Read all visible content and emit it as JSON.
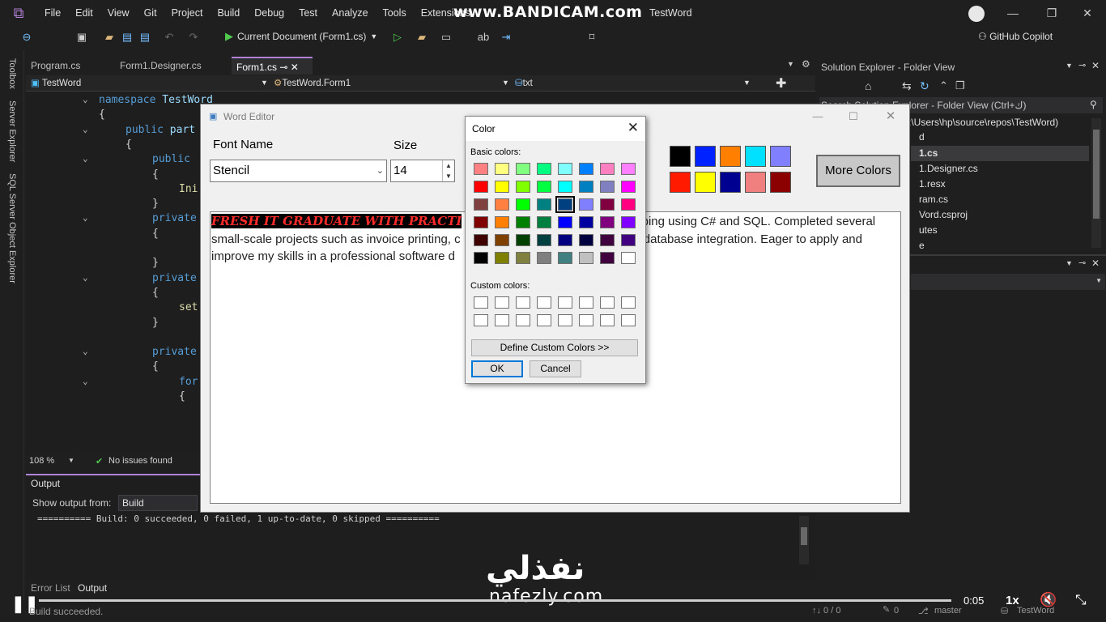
{
  "menubar": {
    "items": [
      "File",
      "Edit",
      "View",
      "Git",
      "Project",
      "Build",
      "Debug",
      "Test",
      "Analyze",
      "Tools",
      "Extensions"
    ],
    "watermark": "www.BANDICAM.com",
    "window_title": "TestWord"
  },
  "toolbar": {
    "run_label": "Current Document (Form1.cs)",
    "copilot_label": "GitHub Copilot"
  },
  "sidebar": {
    "toolbox": "Toolbox",
    "server_explorer": "Server Explorer",
    "sql_explorer": "SQL Server Object Explorer"
  },
  "editor": {
    "tabs": [
      "Program.cs",
      "Form1.Designer.cs",
      "Form1.cs"
    ],
    "nav_project": "TestWord",
    "nav_class": "TestWord.Form1",
    "nav_member": "txt",
    "lines": [
      {
        "indent": 0,
        "kw": "namespace",
        "text": " TestWord"
      },
      {
        "indent": 0,
        "kw": "",
        "text": "{"
      },
      {
        "indent": 1,
        "kw": "public",
        "text": " part"
      },
      {
        "indent": 1,
        "kw": "",
        "text": "{"
      },
      {
        "indent": 2,
        "kw": "public",
        "text": ""
      },
      {
        "indent": 2,
        "kw": "",
        "text": "{"
      },
      {
        "indent": 3,
        "kw": "",
        "text": "Ini"
      },
      {
        "indent": 2,
        "kw": "",
        "text": "}"
      },
      {
        "indent": 2,
        "kw": "private",
        "text": ""
      },
      {
        "indent": 2,
        "kw": "",
        "text": "{"
      },
      {
        "indent": 2,
        "kw": "",
        "text": ""
      },
      {
        "indent": 2,
        "kw": "",
        "text": "}"
      },
      {
        "indent": 2,
        "kw": "private",
        "text": ""
      },
      {
        "indent": 2,
        "kw": "",
        "text": "{"
      },
      {
        "indent": 3,
        "kw": "",
        "text": "set"
      },
      {
        "indent": 2,
        "kw": "",
        "text": "}"
      },
      {
        "indent": 2,
        "kw": "",
        "text": ""
      },
      {
        "indent": 2,
        "kw": "private",
        "text": ""
      },
      {
        "indent": 2,
        "kw": "",
        "text": "{"
      },
      {
        "indent": 3,
        "kw": "for",
        "text": ""
      },
      {
        "indent": 3,
        "kw": "",
        "text": "{"
      }
    ],
    "zoom": "108 %",
    "issues": "No issues found"
  },
  "output": {
    "title": "Output",
    "show_from_label": "Show output from:",
    "show_from_value": "Build",
    "text": "========== Build: 0 succeeded, 0 failed, 1 up-to-date, 0 skipped =========="
  },
  "bottom_tabs": [
    "Error List",
    "Output"
  ],
  "solution": {
    "title": "Solution Explorer - Folder View",
    "search": "Search Solution Explorer - Folder View (Ctrl+ك)",
    "path": ":\\Users\\hp\\source\\repos\\TestWord)",
    "rows": [
      "d",
      "1.cs",
      "1.Designer.cs",
      "1.resx",
      "ram.cs",
      "Vord.csproj",
      "utes",
      "e"
    ]
  },
  "status": {
    "message": "Build succeeded.",
    "time": "0:05",
    "speed": "1x",
    "counts": "↑↓ 0 / 0",
    "pencil": "0",
    "branch": "master",
    "repo": "TestWord"
  },
  "brand": {
    "arabic": "نفذلي",
    "latin": "nafezly.com"
  },
  "form": {
    "title": "Word Editor",
    "font_label": "Font Name",
    "size_label": "Size",
    "font_value": "Stencil",
    "size_value": "14",
    "more_colors": "More Colors",
    "swatches_row1": [
      "#000000",
      "#0022ff",
      "#ff8000",
      "#00e0ff",
      "#8080ff"
    ],
    "swatches_row2": [
      "#ff1a00",
      "#ffff00",
      "#000090",
      "#f08080",
      "#8b0000"
    ],
    "text_highlight": "FRESH IT GRADUATE WITH PRACTI",
    "text_line1_end": "oping using C# and SQL. Completed several",
    "text_line2a": "small-scale projects such as invoice printing, c",
    "text_line2b": " database integration. Eager to apply and",
    "text_line3": "improve my skills in a professional software d"
  },
  "color_dialog": {
    "title": "Color",
    "basic_label": "Basic colors:",
    "custom_label": "Custom colors:",
    "define_btn": "Define Custom Colors >>",
    "ok": "OK",
    "cancel": "Cancel",
    "basic_colors": [
      [
        "#ff8080",
        "#ffff80",
        "#80ff80",
        "#00ff80",
        "#80ffff",
        "#0080ff",
        "#ff80c0",
        "#ff80ff"
      ],
      [
        "#ff0000",
        "#ffff00",
        "#80ff00",
        "#00ff40",
        "#00ffff",
        "#0080c0",
        "#8080c0",
        "#ff00ff"
      ],
      [
        "#804040",
        "#ff8040",
        "#00ff00",
        "#008080",
        "#004080",
        "#8080ff",
        "#800040",
        "#ff0080"
      ],
      [
        "#800000",
        "#ff8000",
        "#008000",
        "#008040",
        "#0000ff",
        "#0000a0",
        "#800080",
        "#8000ff"
      ],
      [
        "#400000",
        "#804000",
        "#004000",
        "#004040",
        "#000080",
        "#000040",
        "#400040",
        "#400080"
      ],
      [
        "#000000",
        "#808000",
        "#808040",
        "#808080",
        "#408080",
        "#c0c0c0",
        "#400040",
        "#ffffff"
      ]
    ],
    "selected": [
      2,
      4
    ]
  }
}
